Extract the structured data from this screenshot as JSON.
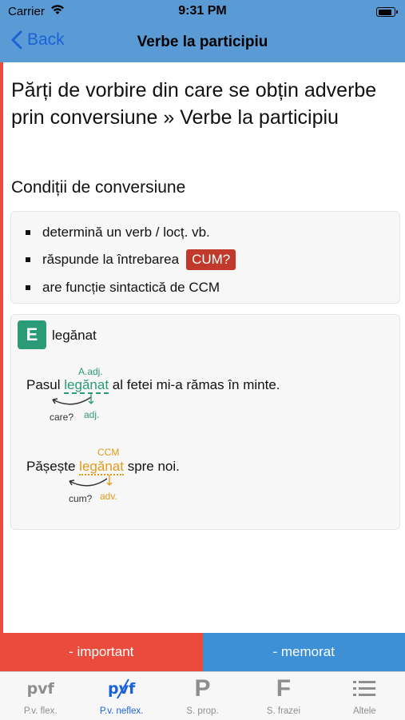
{
  "status": {
    "carrier": "Carrier",
    "time": "9:31 PM",
    "battery_level": 0.76
  },
  "nav": {
    "back_label": "Back",
    "title": "Verbe la participiu"
  },
  "content": {
    "heading": "Părți de vorbire din care se obțin adverbe prin conversiune » Verbe la participiu",
    "section_title": "Condiții de conversiune",
    "conditions": {
      "item1": "determină un verb / locț. vb.",
      "item2_text": "răspunde la întrebarea",
      "item2_badge": "CUM?",
      "item3": "are funcție sintactică de CCM"
    },
    "example": {
      "badge": "E",
      "word": "legănat",
      "s1": {
        "label_top": "A.adj.",
        "before": "Pasul",
        "highlight": "legănat",
        "after": "al fetei mi-a rămas în minte.",
        "question": "care?",
        "part": "adj."
      },
      "s2": {
        "label_top": "CCM",
        "before": "Pășește",
        "highlight": "legănat",
        "after": "spre noi.",
        "question": "cum?",
        "part": "adv."
      }
    }
  },
  "actions": {
    "important": "- important",
    "memorat": "- memorat",
    "important_color": "#ea4b3c",
    "memorat_color": "#3d8fd6"
  },
  "tabs": [
    {
      "label": "P.v. flex.",
      "icon": "pvf-icon"
    },
    {
      "label": "P.v. neflex.",
      "icon": "pvf-crossed-icon"
    },
    {
      "label": "S. prop.",
      "icon": "letter-p-icon"
    },
    {
      "label": "S. frazei",
      "icon": "letter-f-icon"
    },
    {
      "label": "Altele",
      "icon": "list-icon"
    }
  ],
  "tab_icon_text": {
    "pvf": "pvf",
    "p": "P",
    "f": "F"
  },
  "active_tab": 1
}
